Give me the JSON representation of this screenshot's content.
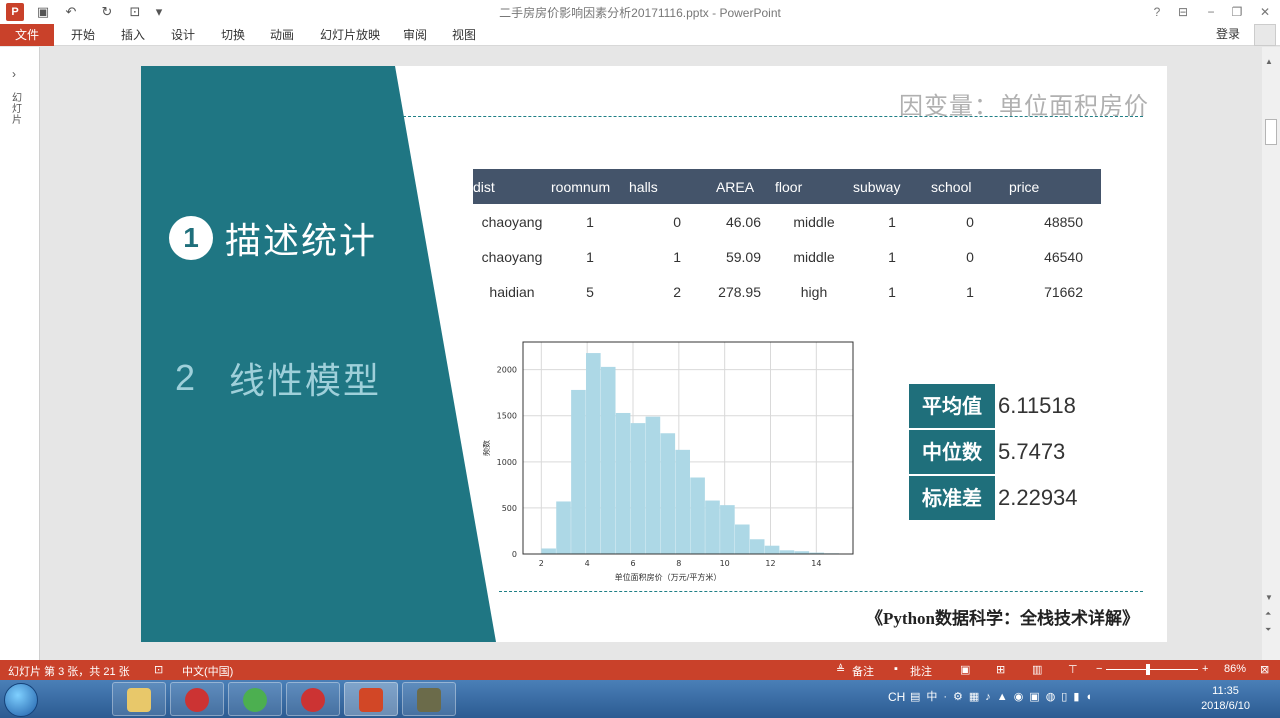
{
  "window": {
    "title": "二手房房价影响因素分析20171116.pptx - PowerPoint",
    "help": "?",
    "minimize": "−",
    "restore": "❐",
    "close": "✕"
  },
  "ribbon": {
    "file": "文件",
    "tabs": [
      "开始",
      "插入",
      "设计",
      "切换",
      "动画",
      "幻灯片放映",
      "审阅",
      "视图"
    ],
    "login": "登录"
  },
  "thumbnails": {
    "label": "幻灯片"
  },
  "slide": {
    "title": "因变量：单位面积房价",
    "menu": [
      {
        "number": "1",
        "text": "描述统计"
      },
      {
        "number": "2",
        "text": "线性模型"
      }
    ],
    "table": {
      "headers": [
        "dist",
        "roomnum",
        "halls",
        "AREA",
        "floor",
        "subway",
        "school",
        "price"
      ],
      "rows": [
        [
          "chaoyang",
          "1",
          "0",
          "46.06",
          "middle",
          "1",
          "0",
          "48850"
        ],
        [
          "chaoyang",
          "1",
          "1",
          "59.09",
          "middle",
          "1",
          "0",
          "46540"
        ],
        [
          "haidian",
          "5",
          "2",
          "278.95",
          "high",
          "1",
          "1",
          "71662"
        ]
      ]
    },
    "stats": [
      {
        "label": "平均值",
        "value": "6.11518"
      },
      {
        "label": "中位数",
        "value": "5.7473"
      },
      {
        "label": "标准差",
        "value": "2.22934"
      }
    ],
    "book": "《Python数据科学：全栈技术详解》"
  },
  "chart_data": {
    "type": "bar",
    "xlabel": "单位面积房价（万元/平方米）",
    "ylabel": "频数",
    "xlim": [
      1.2,
      15.6
    ],
    "ylim": [
      0,
      2300
    ],
    "xticks": [
      "2",
      "4",
      "6",
      "8",
      "10",
      "12",
      "14"
    ],
    "yticks": [
      "0",
      "500",
      "1000",
      "1500",
      "2000"
    ],
    "bin_edges": [
      2.0,
      2.65,
      3.3,
      3.95,
      4.6,
      5.25,
      5.9,
      6.55,
      7.2,
      7.85,
      8.5,
      9.15,
      9.8,
      10.45,
      11.1,
      11.75,
      12.4,
      13.05,
      13.7,
      14.35,
      15.0
    ],
    "counts": [
      60,
      570,
      1780,
      2180,
      2030,
      1530,
      1420,
      1490,
      1310,
      1130,
      830,
      580,
      530,
      320,
      160,
      90,
      40,
      30,
      15,
      8
    ],
    "bar_color": "#add8e6",
    "grid": true
  },
  "statusbar": {
    "slide_info": "幻灯片 第 3 张，共 21 张",
    "language": "中文(中国)",
    "notes": "备注",
    "comments": "批注",
    "zoom": "86%"
  },
  "taskbar": {
    "time": "11:35",
    "date": "2018/6/10",
    "ime": "CH",
    "apps": [
      "file-explorer",
      "web-app-1",
      "sync-app",
      "web-app-2",
      "powerpoint",
      "media-app"
    ]
  }
}
